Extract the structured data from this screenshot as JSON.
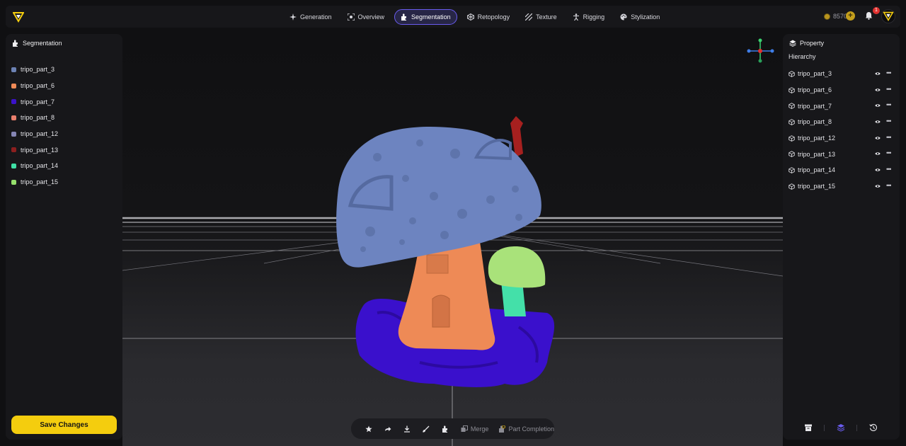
{
  "header": {
    "nav": [
      {
        "label": "Generation",
        "icon": "sparkle-icon",
        "active": false
      },
      {
        "label": "Overview",
        "icon": "focus-icon",
        "active": false
      },
      {
        "label": "Segmentation",
        "icon": "puzzle-icon",
        "active": true
      },
      {
        "label": "Retopology",
        "icon": "mesh-icon",
        "active": false
      },
      {
        "label": "Texture",
        "icon": "texture-icon",
        "active": false
      },
      {
        "label": "Rigging",
        "icon": "figure-icon",
        "active": false
      },
      {
        "label": "Stylization",
        "icon": "palette-icon",
        "active": false
      }
    ],
    "credits": "8570",
    "notification_count": "1"
  },
  "left_panel": {
    "title": "Segmentation",
    "parts": [
      {
        "label": "tripo_part_3",
        "color": "#6c82b4"
      },
      {
        "label": "tripo_part_6",
        "color": "#ef8a57"
      },
      {
        "label": "tripo_part_7",
        "color": "#3b12c9"
      },
      {
        "label": "tripo_part_8",
        "color": "#ea7f6d"
      },
      {
        "label": "tripo_part_12",
        "color": "#8686b4"
      },
      {
        "label": "tripo_part_13",
        "color": "#8c1f1f"
      },
      {
        "label": "tripo_part_14",
        "color": "#3fe0a6"
      },
      {
        "label": "tripo_part_15",
        "color": "#95e06c"
      }
    ],
    "save_label": "Save Changes"
  },
  "toolbar": {
    "merge_label": "Merge",
    "part_completion_label": "Part Completion"
  },
  "right_panel": {
    "title": "Property",
    "hierarchy_label": "Hierarchy",
    "items": [
      "tripo_part_3",
      "tripo_part_6",
      "tripo_part_7",
      "tripo_part_8",
      "tripo_part_12",
      "tripo_part_13",
      "tripo_part_14",
      "tripo_part_15"
    ]
  },
  "colors": {
    "accent_yellow": "#f4cd0e",
    "active_tab_border": "#6a5cf0"
  }
}
